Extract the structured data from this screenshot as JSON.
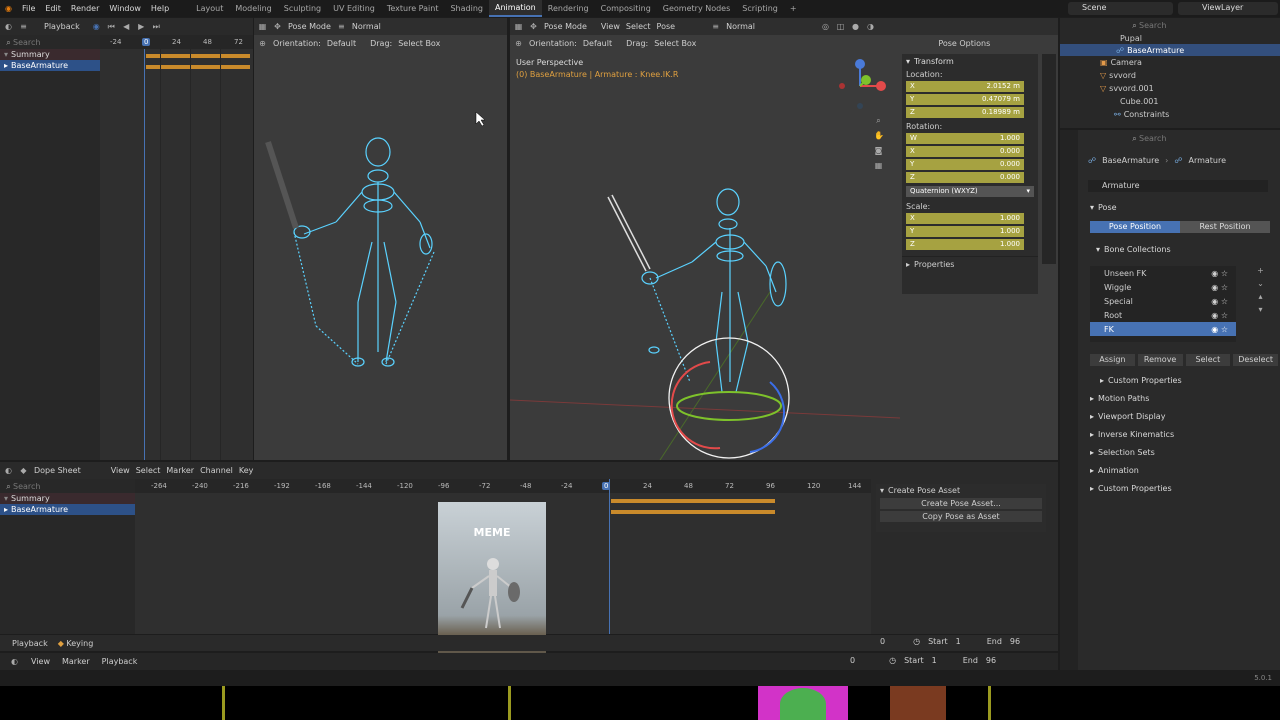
{
  "menu": [
    "File",
    "Edit",
    "Render",
    "Window",
    "Help"
  ],
  "workspaces": [
    "Layout",
    "Modeling",
    "Sculpting",
    "UV Editing",
    "Texture Paint",
    "Shading",
    "Animation",
    "Rendering",
    "Compositing",
    "Geometry Nodes",
    "Scripting"
  ],
  "active_workspace": "Animation",
  "scene": "Scene",
  "view_layer": "ViewLayer",
  "top_left": {
    "playback": "Playback",
    "search_placeholder": "Search",
    "frame_ticks": [
      "-24",
      "0",
      "24",
      "48",
      "72"
    ],
    "rows": [
      "Summary",
      "BaseArmature"
    ]
  },
  "viewport_left": {
    "mode": "Pose Mode",
    "shading": "Normal",
    "orientation_label": "Orientation:",
    "orientation": "Default",
    "drag_label": "Drag:",
    "drag": "Select Box"
  },
  "viewport_main": {
    "mode": "Pose Mode",
    "menus": [
      "View",
      "Select",
      "Pose"
    ],
    "shading": "Normal",
    "orientation_label": "Orientation:",
    "orientation": "Default",
    "drag_label": "Drag:",
    "drag": "Select Box",
    "pose_options": "Pose Options",
    "perspective": "User Perspective",
    "context": "(0) BaseArmature | Armature : Knee.IK.R"
  },
  "transform": {
    "title": "Transform",
    "location_label": "Location:",
    "location": [
      [
        "X",
        "2.0152 m"
      ],
      [
        "Y",
        "0.47079 m"
      ],
      [
        "Z",
        "0.18989 m"
      ]
    ],
    "rotation_label": "Rotation:",
    "rotation": [
      [
        "W",
        "1.000"
      ],
      [
        "X",
        "0.000"
      ],
      [
        "Y",
        "0.000"
      ],
      [
        "Z",
        "0.000"
      ]
    ],
    "rotation_mode": "Quaternion (WXYZ)",
    "scale_label": "Scale:",
    "scale": [
      [
        "X",
        "1.000"
      ],
      [
        "Y",
        "1.000"
      ],
      [
        "Z",
        "1.000"
      ]
    ],
    "properties": "Properties"
  },
  "outliner": {
    "items": [
      "Pupal",
      "BaseArmature",
      "Camera",
      "svvord",
      "svvord.001",
      "Cube.001",
      "Constraints"
    ],
    "search_placeholder": "Search"
  },
  "properties_panel": {
    "breadcrumb_object": "BaseArmature",
    "breadcrumb_data": "Armature",
    "data_name": "Armature",
    "pose_section": "Pose",
    "pose_position": "Pose Position",
    "rest_position": "Rest Position",
    "bone_collections": "Bone Collections",
    "collections": [
      "Unseen FK",
      "Wiggle",
      "Special",
      "Root",
      "FK"
    ],
    "assign": "Assign",
    "remove": "Remove",
    "select": "Select",
    "deselect": "Deselect",
    "custom_properties_inner": "Custom Properties",
    "sections": [
      "Motion Paths",
      "Viewport Display",
      "Inverse Kinematics",
      "Selection Sets",
      "Animation",
      "Custom Properties"
    ]
  },
  "dope_sheet": {
    "editor": "Dope Sheet",
    "menus": [
      "View",
      "Select",
      "Marker",
      "Channel",
      "Key"
    ],
    "search_placeholder": "Search",
    "ticks": [
      "-264",
      "-240",
      "-216",
      "-192",
      "-168",
      "-144",
      "-120",
      "-96",
      "-72",
      "-48",
      "-24",
      "0",
      "24",
      "48",
      "72",
      "96",
      "120",
      "144"
    ],
    "current_frame_label": "0",
    "rows": [
      "Summary",
      "BaseArmature"
    ],
    "create_pose_asset_header": "Create Pose Asset",
    "create_pose_asset_btn": "Create Pose Asset...",
    "copy_pose_btn": "Copy Pose as Asset"
  },
  "meme_text": "MEME",
  "timeline_mid": {
    "playback": "Playback",
    "keying": "Keying",
    "frame": "0",
    "start_label": "Start",
    "start": "1",
    "end_label": "End",
    "end": "96"
  },
  "timeline_bottom": {
    "menus": [
      "View",
      "Marker",
      "Playback"
    ],
    "frame": "0",
    "start_label": "Start",
    "start": "1",
    "end_label": "End",
    "end": "96"
  },
  "version": "5.0.1",
  "colors": {
    "accent": "#4772b3",
    "keyframe": "#c98a2b",
    "bone": "#5ad2ff",
    "field_yellow": "#a6a241"
  }
}
